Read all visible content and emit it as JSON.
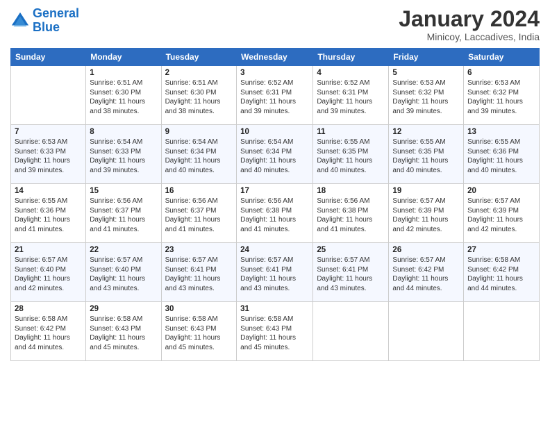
{
  "logo": {
    "line1": "General",
    "line2": "Blue"
  },
  "title": "January 2024",
  "subtitle": "Minicoy, Laccadives, India",
  "weekdays": [
    "Sunday",
    "Monday",
    "Tuesday",
    "Wednesday",
    "Thursday",
    "Friday",
    "Saturday"
  ],
  "weeks": [
    [
      {
        "day": "",
        "info": ""
      },
      {
        "day": "1",
        "info": "Sunrise: 6:51 AM\nSunset: 6:30 PM\nDaylight: 11 hours\nand 38 minutes."
      },
      {
        "day": "2",
        "info": "Sunrise: 6:51 AM\nSunset: 6:30 PM\nDaylight: 11 hours\nand 38 minutes."
      },
      {
        "day": "3",
        "info": "Sunrise: 6:52 AM\nSunset: 6:31 PM\nDaylight: 11 hours\nand 39 minutes."
      },
      {
        "day": "4",
        "info": "Sunrise: 6:52 AM\nSunset: 6:31 PM\nDaylight: 11 hours\nand 39 minutes."
      },
      {
        "day": "5",
        "info": "Sunrise: 6:53 AM\nSunset: 6:32 PM\nDaylight: 11 hours\nand 39 minutes."
      },
      {
        "day": "6",
        "info": "Sunrise: 6:53 AM\nSunset: 6:32 PM\nDaylight: 11 hours\nand 39 minutes."
      }
    ],
    [
      {
        "day": "7",
        "info": "Sunrise: 6:53 AM\nSunset: 6:33 PM\nDaylight: 11 hours\nand 39 minutes."
      },
      {
        "day": "8",
        "info": "Sunrise: 6:54 AM\nSunset: 6:33 PM\nDaylight: 11 hours\nand 39 minutes."
      },
      {
        "day": "9",
        "info": "Sunrise: 6:54 AM\nSunset: 6:34 PM\nDaylight: 11 hours\nand 40 minutes."
      },
      {
        "day": "10",
        "info": "Sunrise: 6:54 AM\nSunset: 6:34 PM\nDaylight: 11 hours\nand 40 minutes."
      },
      {
        "day": "11",
        "info": "Sunrise: 6:55 AM\nSunset: 6:35 PM\nDaylight: 11 hours\nand 40 minutes."
      },
      {
        "day": "12",
        "info": "Sunrise: 6:55 AM\nSunset: 6:35 PM\nDaylight: 11 hours\nand 40 minutes."
      },
      {
        "day": "13",
        "info": "Sunrise: 6:55 AM\nSunset: 6:36 PM\nDaylight: 11 hours\nand 40 minutes."
      }
    ],
    [
      {
        "day": "14",
        "info": "Sunrise: 6:55 AM\nSunset: 6:36 PM\nDaylight: 11 hours\nand 41 minutes."
      },
      {
        "day": "15",
        "info": "Sunrise: 6:56 AM\nSunset: 6:37 PM\nDaylight: 11 hours\nand 41 minutes."
      },
      {
        "day": "16",
        "info": "Sunrise: 6:56 AM\nSunset: 6:37 PM\nDaylight: 11 hours\nand 41 minutes."
      },
      {
        "day": "17",
        "info": "Sunrise: 6:56 AM\nSunset: 6:38 PM\nDaylight: 11 hours\nand 41 minutes."
      },
      {
        "day": "18",
        "info": "Sunrise: 6:56 AM\nSunset: 6:38 PM\nDaylight: 11 hours\nand 41 minutes."
      },
      {
        "day": "19",
        "info": "Sunrise: 6:57 AM\nSunset: 6:39 PM\nDaylight: 11 hours\nand 42 minutes."
      },
      {
        "day": "20",
        "info": "Sunrise: 6:57 AM\nSunset: 6:39 PM\nDaylight: 11 hours\nand 42 minutes."
      }
    ],
    [
      {
        "day": "21",
        "info": "Sunrise: 6:57 AM\nSunset: 6:40 PM\nDaylight: 11 hours\nand 42 minutes."
      },
      {
        "day": "22",
        "info": "Sunrise: 6:57 AM\nSunset: 6:40 PM\nDaylight: 11 hours\nand 43 minutes."
      },
      {
        "day": "23",
        "info": "Sunrise: 6:57 AM\nSunset: 6:41 PM\nDaylight: 11 hours\nand 43 minutes."
      },
      {
        "day": "24",
        "info": "Sunrise: 6:57 AM\nSunset: 6:41 PM\nDaylight: 11 hours\nand 43 minutes."
      },
      {
        "day": "25",
        "info": "Sunrise: 6:57 AM\nSunset: 6:41 PM\nDaylight: 11 hours\nand 43 minutes."
      },
      {
        "day": "26",
        "info": "Sunrise: 6:57 AM\nSunset: 6:42 PM\nDaylight: 11 hours\nand 44 minutes."
      },
      {
        "day": "27",
        "info": "Sunrise: 6:58 AM\nSunset: 6:42 PM\nDaylight: 11 hours\nand 44 minutes."
      }
    ],
    [
      {
        "day": "28",
        "info": "Sunrise: 6:58 AM\nSunset: 6:42 PM\nDaylight: 11 hours\nand 44 minutes."
      },
      {
        "day": "29",
        "info": "Sunrise: 6:58 AM\nSunset: 6:43 PM\nDaylight: 11 hours\nand 45 minutes."
      },
      {
        "day": "30",
        "info": "Sunrise: 6:58 AM\nSunset: 6:43 PM\nDaylight: 11 hours\nand 45 minutes."
      },
      {
        "day": "31",
        "info": "Sunrise: 6:58 AM\nSunset: 6:43 PM\nDaylight: 11 hours\nand 45 minutes."
      },
      {
        "day": "",
        "info": ""
      },
      {
        "day": "",
        "info": ""
      },
      {
        "day": "",
        "info": ""
      }
    ]
  ]
}
